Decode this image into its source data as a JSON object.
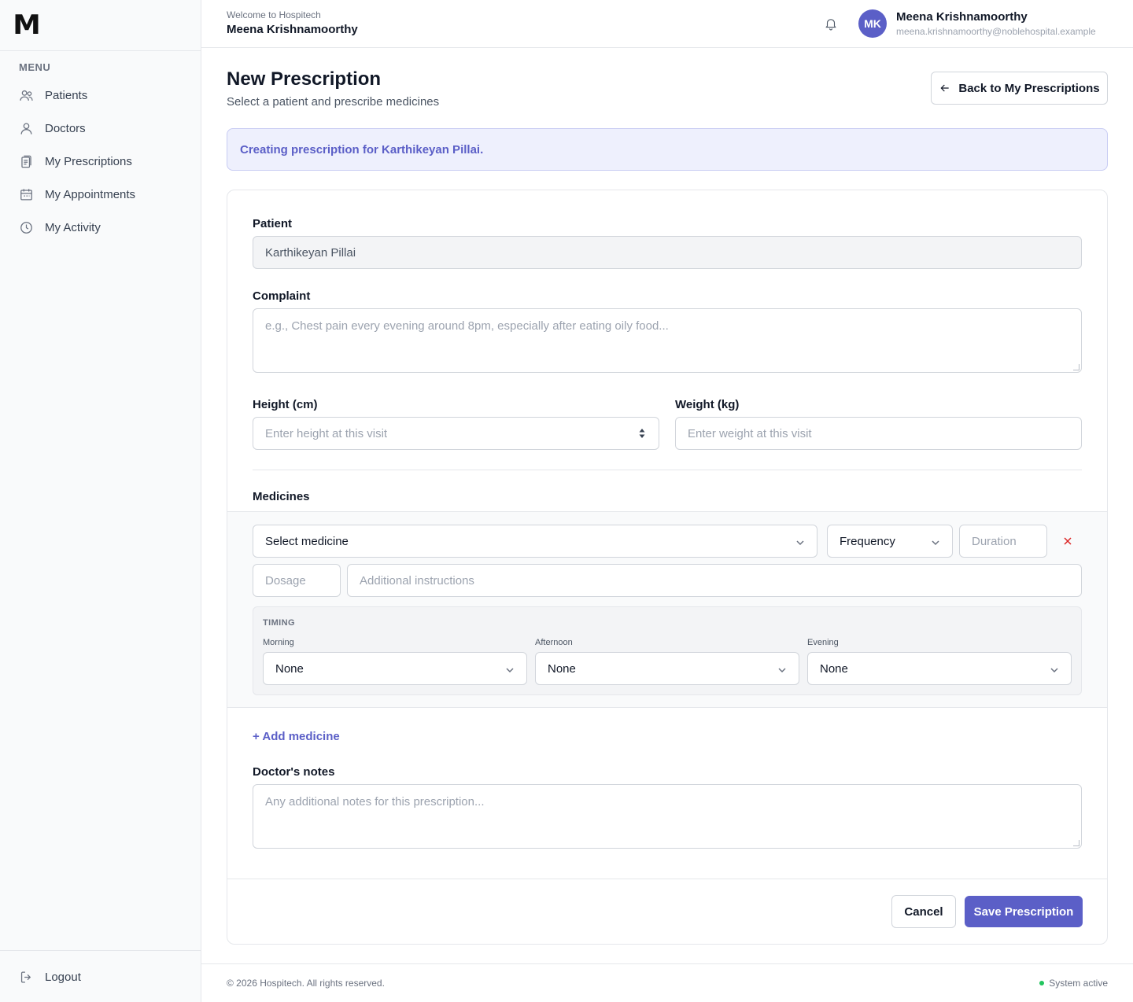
{
  "brand": {
    "logo_letter": "M"
  },
  "sidebar": {
    "menu_heading": "MENU",
    "items": [
      {
        "label": "Patients",
        "icon": "users-icon"
      },
      {
        "label": "Doctors",
        "icon": "user-icon"
      },
      {
        "label": "My Prescriptions",
        "icon": "clipboard-icon"
      },
      {
        "label": "My Appointments",
        "icon": "calendar-icon"
      },
      {
        "label": "My Activity",
        "icon": "clock-icon"
      }
    ],
    "logout_label": "Logout"
  },
  "topbar": {
    "welcome": "Welcome to Hospitech",
    "user_name": "Meena Krishnamoorthy",
    "avatar_initials": "MK",
    "profile_name": "Meena Krishnamoorthy",
    "profile_email": "meena.krishnamoorthy@noblehospital.example"
  },
  "page": {
    "title": "New Prescription",
    "subtitle": "Select a patient and prescribe medicines",
    "back_button": "Back to My Prescriptions",
    "banner": "Creating prescription for Karthikeyan Pillai."
  },
  "form": {
    "patient_label": "Patient",
    "patient_value": "Karthikeyan Pillai",
    "complaint_label": "Complaint",
    "complaint_placeholder": "e.g., Chest pain every evening around 8pm, especially after eating oily food...",
    "height_label": "Height (cm)",
    "height_placeholder": "Enter height at this visit",
    "weight_label": "Weight (kg)",
    "weight_placeholder": "Enter weight at this visit",
    "medicines_label": "Medicines",
    "medicine": {
      "select_medicine": "Select medicine",
      "frequency": "Frequency",
      "duration_placeholder": "Duration",
      "dosage_placeholder": "Dosage",
      "instructions_placeholder": "Additional instructions",
      "timing_title": "TIMING",
      "morning_label": "Morning",
      "morning_value": "None",
      "afternoon_label": "Afternoon",
      "afternoon_value": "None",
      "evening_label": "Evening",
      "evening_value": "None"
    },
    "add_medicine": "+ Add medicine",
    "notes_label": "Doctor's notes",
    "notes_placeholder": "Any additional notes for this prescription...",
    "cancel": "Cancel",
    "save": "Save Prescription"
  },
  "footer": {
    "copyright": "© 2026 Hospitech. All rights reserved.",
    "status": "System active"
  },
  "colors": {
    "accent": "#5b5fc7",
    "status_ok": "#22c55e",
    "danger": "#dc2626"
  }
}
